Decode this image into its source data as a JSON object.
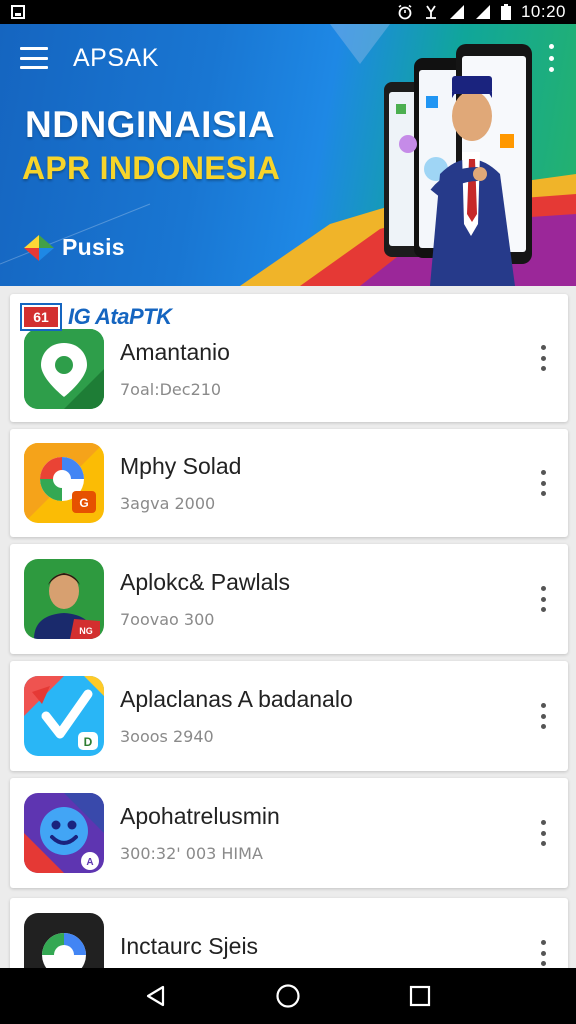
{
  "status_bar": {
    "time": "10:20",
    "icons": [
      "notification-icon",
      "alarm-icon",
      "vibrate-icon",
      "signal-icon",
      "signal-icon",
      "battery-icon"
    ]
  },
  "app_bar": {
    "title": "APSAK",
    "menu_icon": "hamburger-menu-icon",
    "overflow_icon": "more-vert-icon"
  },
  "hero": {
    "headline_1": "NDNGINAISIA",
    "headline_2": "APR INDONESIA",
    "brand_label": "Pusis"
  },
  "section": {
    "badge": "61",
    "label": "IG AtaPTK"
  },
  "apps": [
    {
      "name": "Amantanio",
      "meta": "7oal:Dec210"
    },
    {
      "name": "Mphy Solad",
      "meta": "3agva 2000"
    },
    {
      "name": "Aplokc& Pawlals",
      "meta": "7oovao 300"
    },
    {
      "name": "Aplaclanas A badanalo",
      "meta": "3ooos 2940"
    },
    {
      "name": "Apohatrelusmin",
      "meta": "300:32' 003 HIMA"
    },
    {
      "name": "Inctaurc Sjeis",
      "meta": ""
    }
  ],
  "colors": {
    "hero_blue": "#1565c0",
    "hero_green": "#26b36a",
    "headline_yellow": "#f7d42b",
    "accent_red": "#d32f2f"
  },
  "nav_bar": {
    "back_icon": "back-triangle-icon",
    "home_icon": "home-circle-icon",
    "recents_icon": "recents-square-icon"
  }
}
